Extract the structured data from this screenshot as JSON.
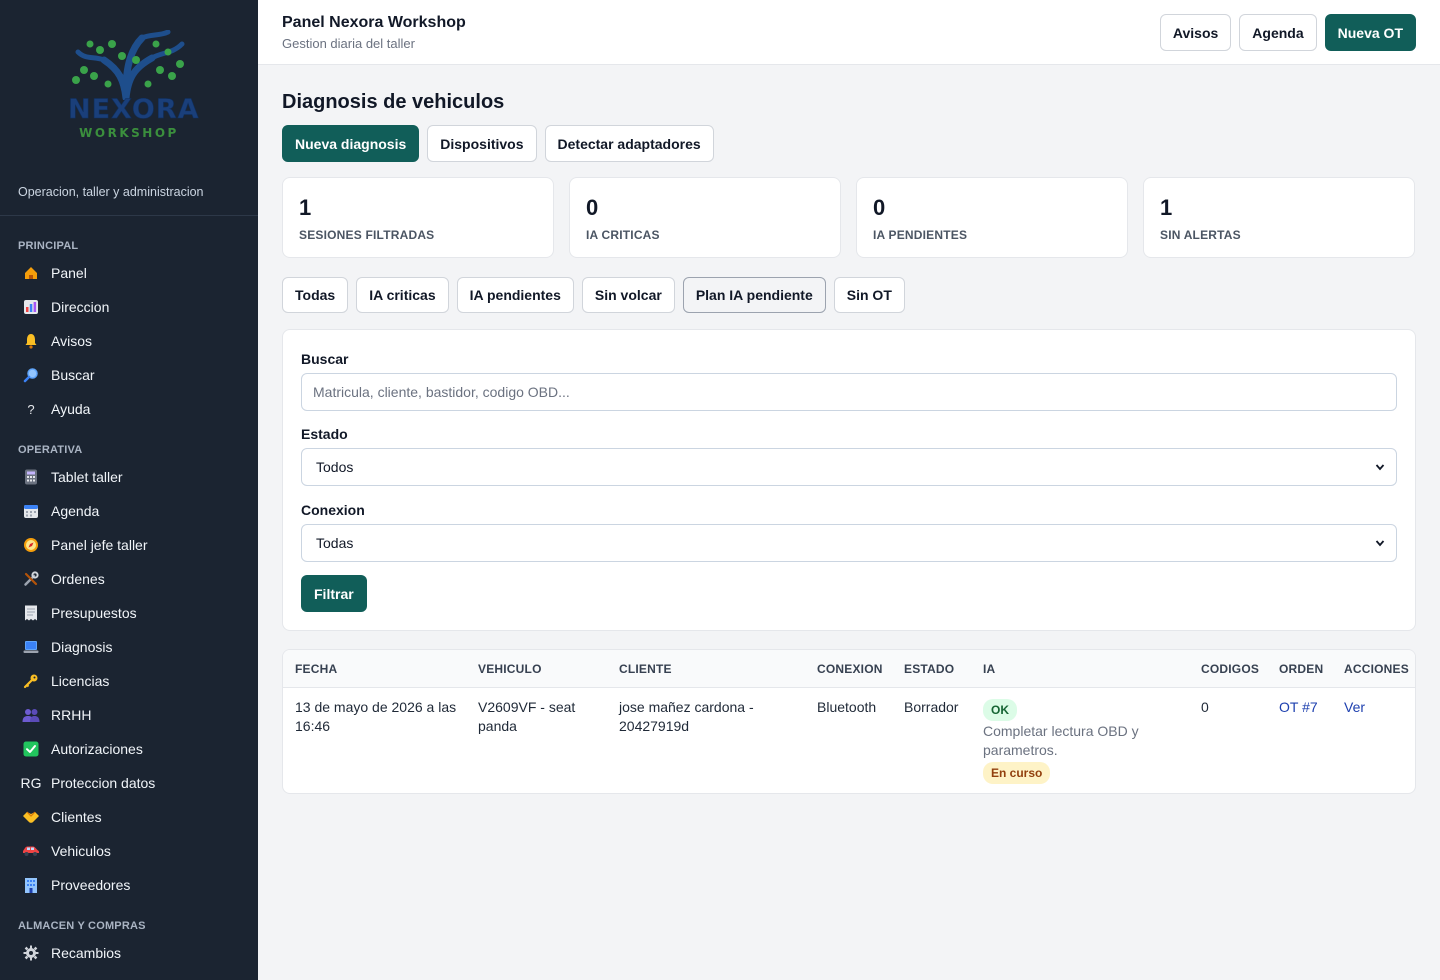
{
  "sidebar": {
    "logo": {
      "word1": "NEXORA",
      "word2": "WORKSHOP"
    },
    "tagline": "Operacion, taller y administracion",
    "sections": [
      {
        "title": "PRINCIPAL",
        "items": [
          {
            "label": "Panel",
            "icon": "home-icon"
          },
          {
            "label": "Direccion",
            "icon": "bar-chart-icon"
          },
          {
            "label": "Avisos",
            "icon": "bell-icon"
          },
          {
            "label": "Buscar",
            "icon": "magnifier-icon"
          },
          {
            "label": "Ayuda",
            "icon": "question-icon"
          }
        ]
      },
      {
        "title": "OPERATIVA",
        "items": [
          {
            "label": "Tablet taller",
            "icon": "calculator-icon"
          },
          {
            "label": "Agenda",
            "icon": "calendar-icon"
          },
          {
            "label": "Panel jefe taller",
            "icon": "compass-icon"
          },
          {
            "label": "Ordenes",
            "icon": "tools-icon"
          },
          {
            "label": "Presupuestos",
            "icon": "receipt-icon"
          },
          {
            "label": "Diagnosis",
            "icon": "laptop-icon"
          },
          {
            "label": "Licencias",
            "icon": "key-icon"
          },
          {
            "label": "RRHH",
            "icon": "people-icon"
          },
          {
            "label": "Autorizaciones",
            "icon": "check-icon"
          },
          {
            "label": "Proteccion datos",
            "icon": "rg-icon",
            "icon_text": "RG"
          },
          {
            "label": "Clientes",
            "icon": "handshake-icon"
          },
          {
            "label": "Vehiculos",
            "icon": "car-icon"
          },
          {
            "label": "Proveedores",
            "icon": "building-icon"
          }
        ]
      },
      {
        "title": "ALMACEN Y COMPRAS",
        "items": [
          {
            "label": "Recambios",
            "icon": "gear-icon"
          }
        ]
      }
    ]
  },
  "topbar": {
    "title": "Panel Nexora Workshop",
    "subtitle": "Gestion diaria del taller",
    "actions": [
      "Avisos",
      "Agenda",
      "Nueva OT"
    ]
  },
  "page": {
    "title": "Diagnosis de vehiculos",
    "actions": [
      "Nueva diagnosis",
      "Dispositivos",
      "Detectar adaptadores"
    ]
  },
  "stats": [
    {
      "value": "1",
      "label": "SESIONES FILTRADAS"
    },
    {
      "value": "0",
      "label": "IA CRITICAS"
    },
    {
      "value": "0",
      "label": "IA PENDIENTES"
    },
    {
      "value": "1",
      "label": "SIN ALERTAS"
    }
  ],
  "filters": [
    "Todas",
    "IA criticas",
    "IA pendientes",
    "Sin volcar",
    "Plan IA pendiente",
    "Sin OT"
  ],
  "form": {
    "search_label": "Buscar",
    "search_placeholder": "Matricula, cliente, bastidor, codigo OBD...",
    "estado_label": "Estado",
    "estado_value": "Todos",
    "conexion_label": "Conexion",
    "conexion_value": "Todas",
    "submit": "Filtrar"
  },
  "table": {
    "headers": [
      "FECHA",
      "VEHICULO",
      "CLIENTE",
      "CONEXION",
      "ESTADO",
      "IA",
      "CODIGOS",
      "ORDEN",
      "ACCIONES"
    ],
    "rows": [
      {
        "fecha_l1": "13 de mayo de 2026 a las",
        "fecha_l2": "16:46",
        "vehiculo_l1": "V2609VF - seat",
        "vehiculo_l2": "panda",
        "cliente_l1": "jose mañez cardona -",
        "cliente_l2": "20427919d",
        "conexion": "Bluetooth",
        "estado": "Borrador",
        "ia_badge": "OK",
        "ia_text_l1": "Completar lectura OBD y",
        "ia_text_l2": "parametros.",
        "ia_status": "En curso",
        "codigos": "0",
        "orden": "OT #7",
        "accion": "Ver"
      }
    ]
  },
  "colors": {
    "sidebar_bg": "#1b2431",
    "primary": "#115e59",
    "page_bg": "#f3f4f6"
  }
}
